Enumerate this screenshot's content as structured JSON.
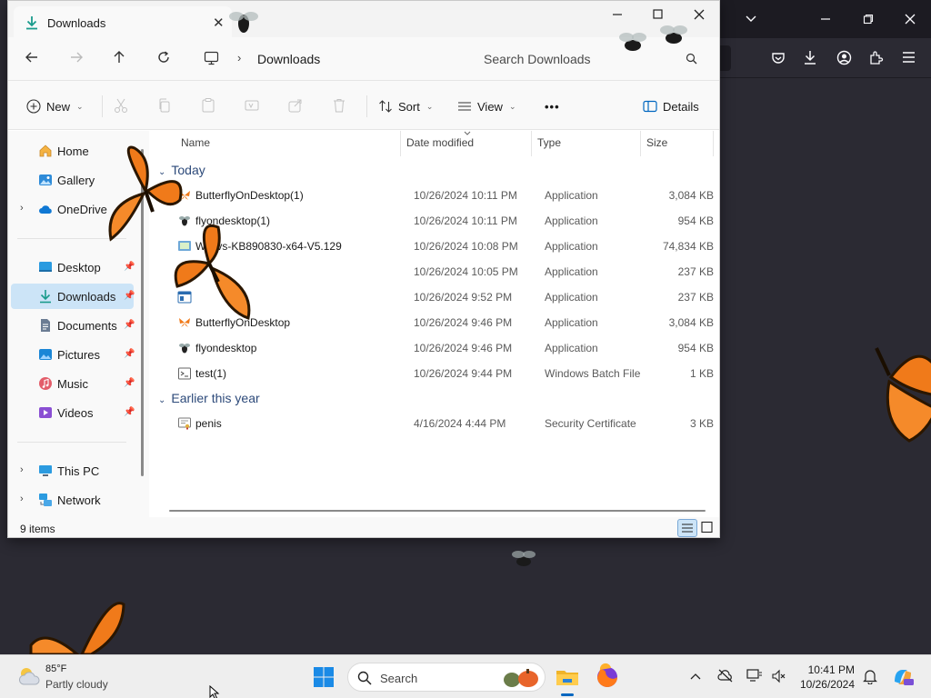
{
  "explorer": {
    "tab_title": "Downloads",
    "address": "Downloads",
    "search_placeholder": "Search Downloads",
    "commands": {
      "new": "New",
      "sort": "Sort",
      "view": "View",
      "more": "•••",
      "details": "Details"
    },
    "sidebar": [
      {
        "label": "Home",
        "icon": "home-icon"
      },
      {
        "label": "Gallery",
        "icon": "gallery-icon"
      },
      {
        "label": "OneDrive",
        "icon": "cloud-icon"
      },
      {
        "label": "Desktop",
        "icon": "desktop-folder-icon"
      },
      {
        "label": "Downloads",
        "icon": "download-icon"
      },
      {
        "label": "Documents",
        "icon": "documents-icon"
      },
      {
        "label": "Pictures",
        "icon": "pictures-icon"
      },
      {
        "label": "Music",
        "icon": "music-icon"
      },
      {
        "label": "Videos",
        "icon": "videos-icon"
      },
      {
        "label": "This PC",
        "icon": "pc-icon"
      },
      {
        "label": "Network",
        "icon": "network-icon"
      }
    ],
    "columns": {
      "name": "Name",
      "date": "Date modified",
      "type": "Type",
      "size": "Size"
    },
    "groups": {
      "today": "Today",
      "earlier": "Earlier this year"
    },
    "files": [
      {
        "name": "ButterflyOnDesktop(1)",
        "date": "10/26/2024 10:11 PM",
        "type": "Application",
        "size": "3,084 KB"
      },
      {
        "name": "flyondesktop(1)",
        "date": "10/26/2024 10:11 PM",
        "type": "Application",
        "size": "954 KB"
      },
      {
        "name": "W…vs-KB890830-x64-V5.129",
        "date": "10/26/2024 10:08 PM",
        "type": "Application",
        "size": "74,834 KB"
      },
      {
        "name": "",
        "date": "10/26/2024 10:05 PM",
        "type": "Application",
        "size": "237 KB"
      },
      {
        "name": "",
        "date": "10/26/2024 9:52 PM",
        "type": "Application",
        "size": "237 KB"
      },
      {
        "name": "ButterflyOnDesktop",
        "date": "10/26/2024 9:46 PM",
        "type": "Application",
        "size": "3,084 KB"
      },
      {
        "name": "flyondesktop",
        "date": "10/26/2024 9:46 PM",
        "type": "Application",
        "size": "954 KB"
      },
      {
        "name": "test(1)",
        "date": "10/26/2024 9:44 PM",
        "type": "Windows Batch File",
        "size": "1 KB"
      },
      {
        "name": "penis",
        "date": "4/16/2024 4:44 PM",
        "type": "Security Certificate",
        "size": "3 KB"
      }
    ],
    "status": "9 items"
  },
  "taskbar": {
    "weather_temp": "85°F",
    "weather_desc": "Partly cloudy",
    "search": "Search",
    "time": "10:41 PM",
    "date": "10/26/2024"
  },
  "colors": {
    "accent": "#0067c0",
    "selection": "#cce4f7",
    "butterfly": "#f07a1a",
    "desktop_bg": "#2b2a33"
  }
}
